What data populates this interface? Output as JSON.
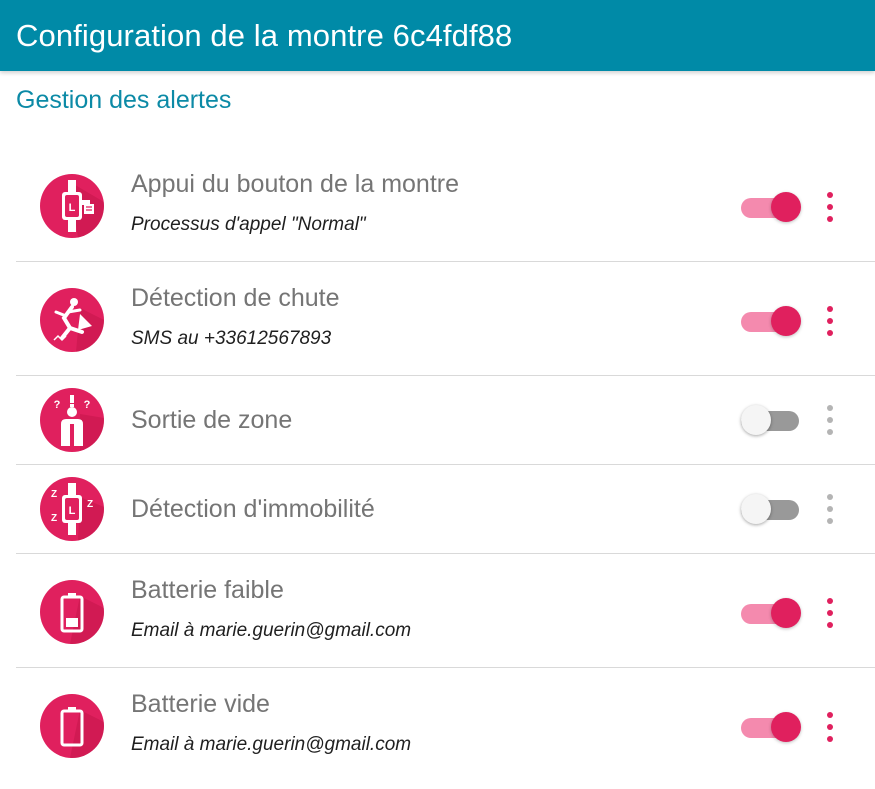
{
  "appbar": {
    "title": "Configuration de la montre 6c4fdf88",
    "color": "#008aa7"
  },
  "section": {
    "title": "Gestion des alertes"
  },
  "colors": {
    "accent": "#e0205e",
    "accent_light": "#f48aae",
    "off_track": "#999999"
  },
  "alerts": [
    {
      "icon": "watch-button-press-icon",
      "title": "Appui du bouton de la montre",
      "subtitle": "Processus d'appel \"Normal\"",
      "enabled": true
    },
    {
      "icon": "fall-detection-icon",
      "title": "Détection de chute",
      "subtitle": "SMS au +33612567893",
      "enabled": true
    },
    {
      "icon": "zone-exit-icon",
      "title": "Sortie de zone",
      "subtitle": "",
      "enabled": false
    },
    {
      "icon": "immobility-icon",
      "title": "Détection d'immobilité",
      "subtitle": "",
      "enabled": false
    },
    {
      "icon": "battery-low-icon",
      "title": "Batterie faible",
      "subtitle": "Email à marie.guerin@gmail.com",
      "enabled": true
    },
    {
      "icon": "battery-empty-icon",
      "title": "Batterie vide",
      "subtitle": "Email à marie.guerin@gmail.com",
      "enabled": true
    }
  ]
}
